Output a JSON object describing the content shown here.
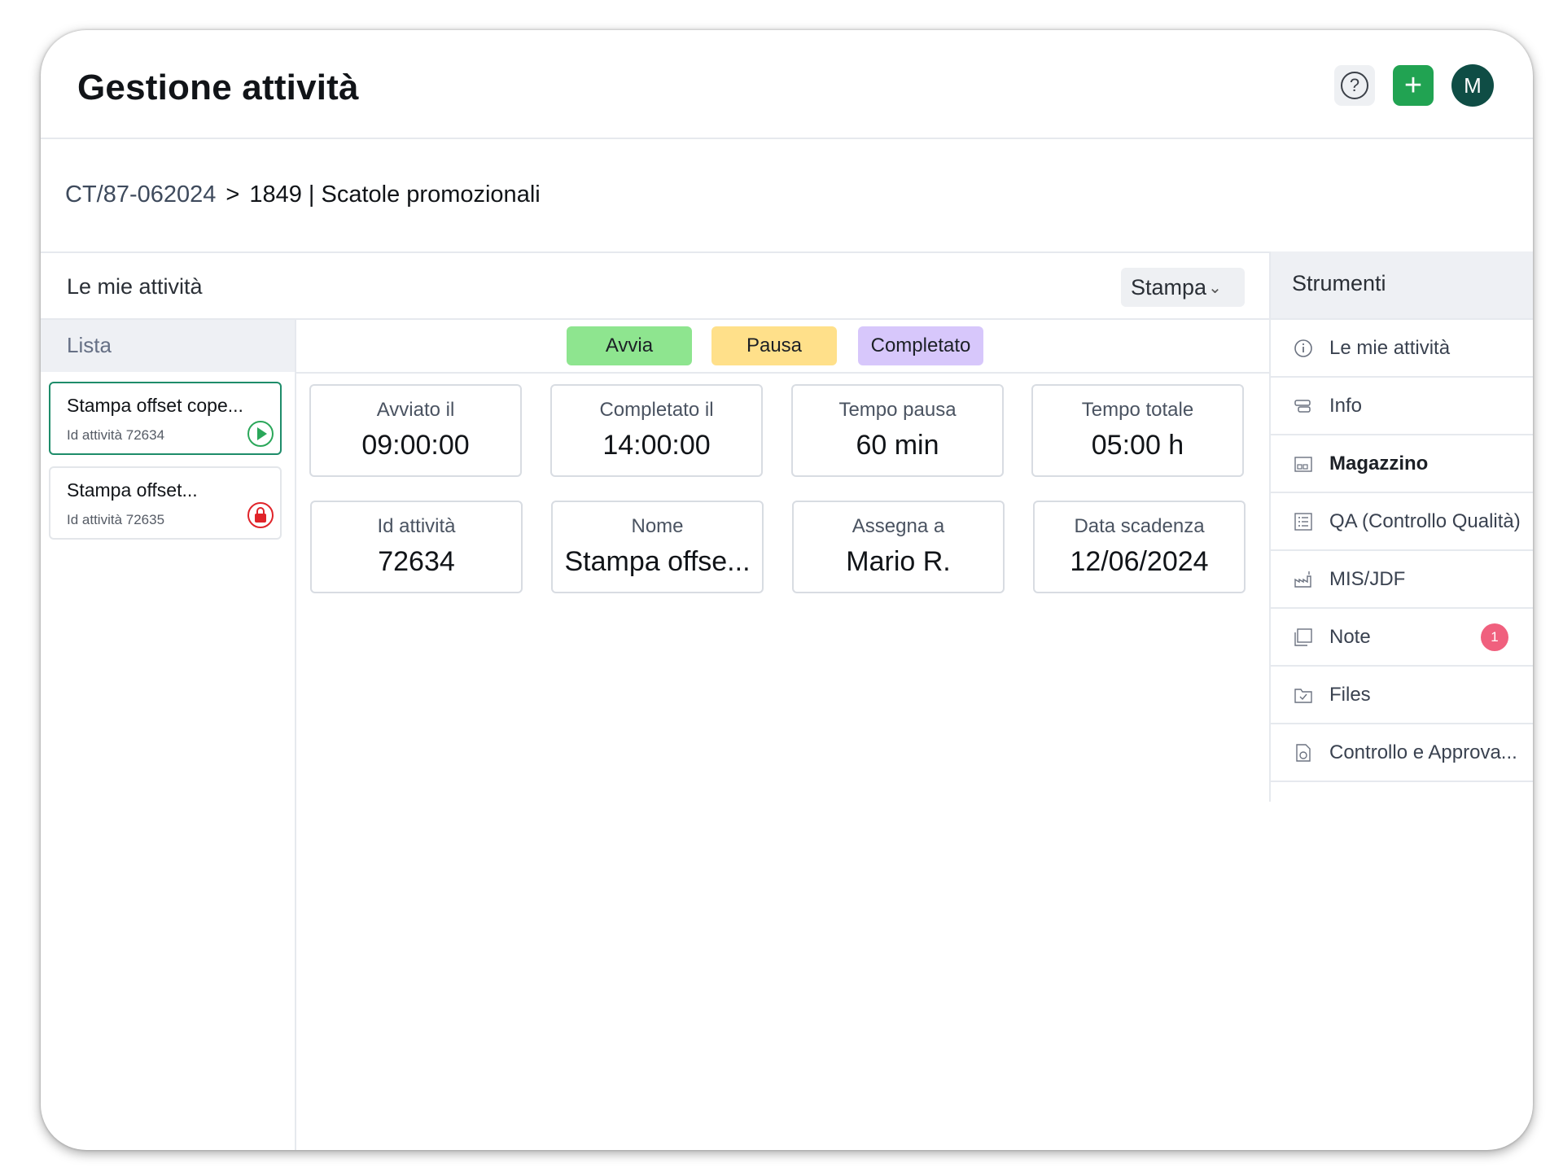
{
  "header": {
    "title": "Gestione attività",
    "help_glyph": "?",
    "add_glyph": "+",
    "avatar_initial": "M"
  },
  "breadcrumb": {
    "parent": "CT/87-062024",
    "separator": ">",
    "current": "1849 | Scatole promozionali"
  },
  "main": {
    "title": "Le mie attività",
    "phase_select": "Stampa",
    "list_header": "Lista",
    "tasks": [
      {
        "name": "Stampa offset cope...",
        "id": "Id attività 72634",
        "state_icon": "play-icon"
      },
      {
        "name": "Stampa offset...",
        "id": "Id attività 72635",
        "state_icon": "lock-icon"
      }
    ],
    "status_buttons": {
      "start": "Avvia",
      "pause": "Pausa",
      "done": "Completato"
    },
    "stats": [
      {
        "label": "Avviato il",
        "value": "09:00:00"
      },
      {
        "label": "Completato il",
        "value": "14:00:00"
      },
      {
        "label": "Tempo pausa",
        "value": "60 min"
      },
      {
        "label": "Tempo totale",
        "value": "05:00 h"
      },
      {
        "label": "Id attività",
        "value": "72634"
      },
      {
        "label": "Nome",
        "value": "Stampa offse..."
      },
      {
        "label": "Assegna a",
        "value": "Mario R."
      },
      {
        "label": "Data scadenza",
        "value": "12/06/2024"
      }
    ]
  },
  "tools": {
    "title": "Strumenti",
    "items": [
      {
        "label": "Le mie attività",
        "icon": "info-circle-icon"
      },
      {
        "label": "Info",
        "icon": "info-icon"
      },
      {
        "label": "Magazzino",
        "icon": "warehouse-icon"
      },
      {
        "label": "QA (Controllo Qualità)",
        "icon": "checklist-icon"
      },
      {
        "label": "MIS/JDF",
        "icon": "factory-icon"
      },
      {
        "label": "Note",
        "icon": "note-icon",
        "badge": "1"
      },
      {
        "label": "Files",
        "icon": "folder-check-icon"
      },
      {
        "label": "Controllo e Approva...",
        "icon": "approval-icon"
      }
    ]
  },
  "colors": {
    "accent_green": "#21a352",
    "avatar_bg": "#0f4d45",
    "start": "#8ee58f",
    "pause": "#ffe08a",
    "done": "#d7c7fb",
    "badge": "#f0607e"
  }
}
